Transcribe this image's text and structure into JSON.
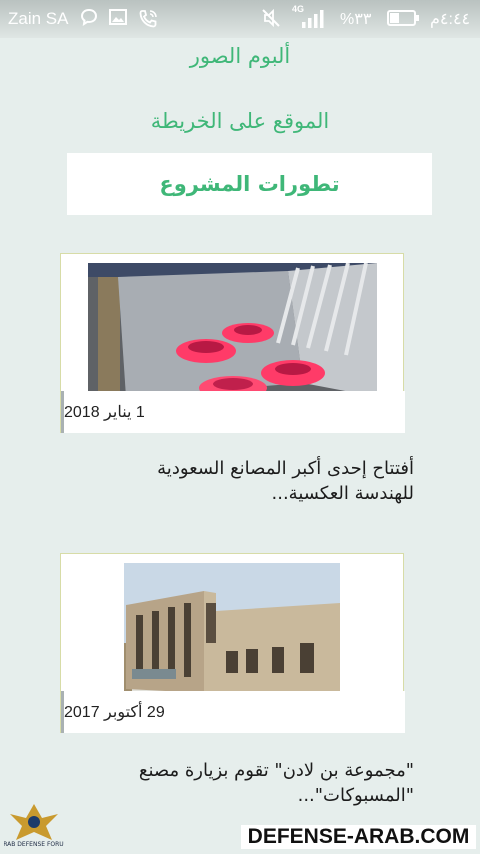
{
  "status_bar": {
    "carrier": "Zain SA",
    "network": "4G",
    "battery": "%٣٣",
    "time": "٤:٤٤م",
    "icons": [
      "chat-bubble-icon",
      "image-icon",
      "phone-call-icon",
      "mute-icon",
      "signal-icon",
      "battery-icon"
    ]
  },
  "menu": {
    "photo_album": "ألبوم الصور",
    "map_location": "الموقع على الخريطة",
    "project_updates": "تطورات المشروع"
  },
  "news": [
    {
      "date": "1 يناير 2018",
      "title_line1": "أفتتاح إحدى أكبر المصانع السعودية",
      "title_line2": "للهندسة العكسية..."
    },
    {
      "date": "29 أكتوبر 2017",
      "title_line1": "\"مجموعة بن لادن\" تقوم بزيارة مصنع",
      "title_line2": "\"المسبوكات\"..."
    }
  ],
  "watermark": {
    "site": "DEFENSE-ARAB.COM",
    "logo_text": "ARAB DEFENSE FORUM"
  },
  "colors": {
    "accent_green": "#3fb778",
    "background": "#e6eeec",
    "card_border": "#d7dca7"
  }
}
